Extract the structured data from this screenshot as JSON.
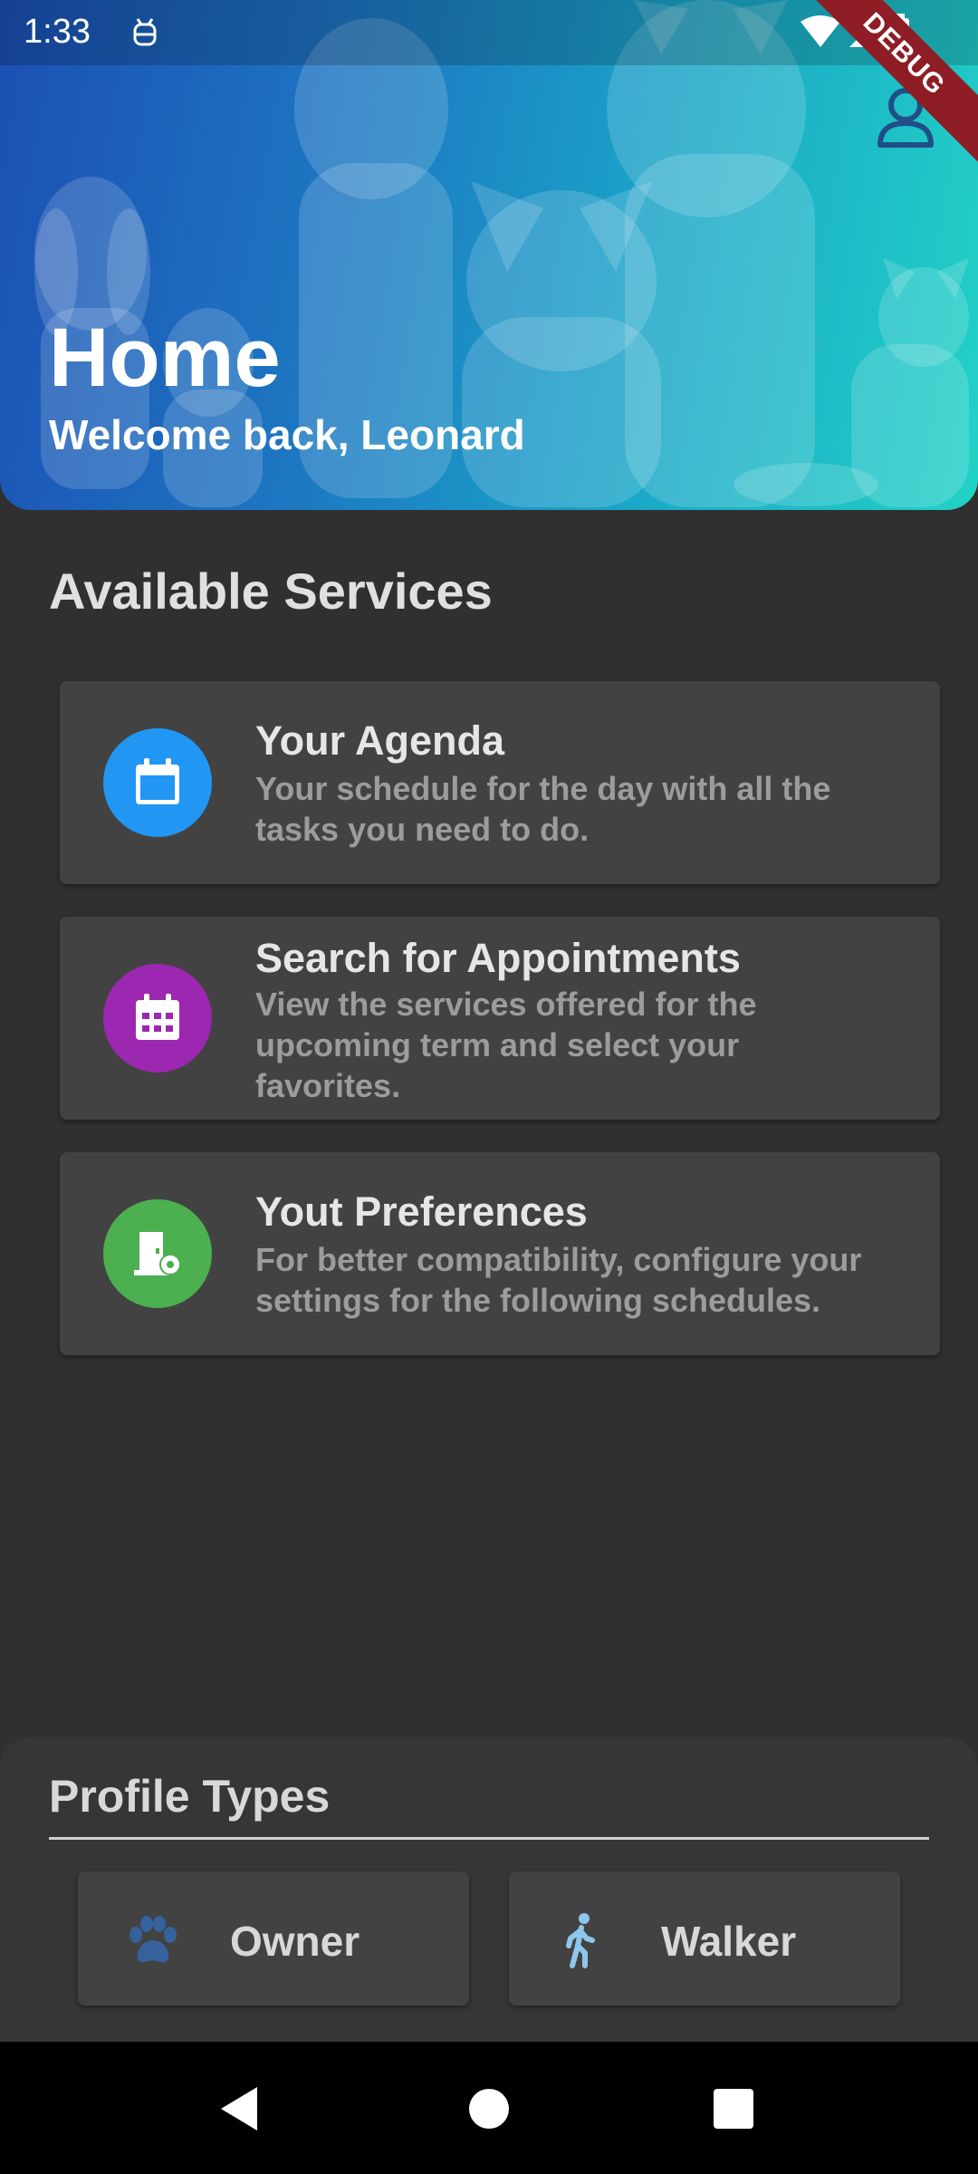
{
  "status_bar": {
    "time": "1:33",
    "icons": [
      "android-debug-icon",
      "wifi-icon",
      "signal-icon",
      "battery-icon"
    ]
  },
  "debug_banner": "DEBUG",
  "header": {
    "title": "Home",
    "subtitle": "Welcome back, Leonard",
    "profile_icon": "person-outline-icon"
  },
  "services": {
    "section_title": "Available Services",
    "items": [
      {
        "title": "Your Agenda",
        "description": "Your schedule for the day with all the tasks you need to do.",
        "icon": "calendar-icon",
        "color": "#2196f3"
      },
      {
        "title": "Search for Appointments",
        "description": "View the services offered for the upcoming term and select your favorites.",
        "icon": "calendar-month-icon",
        "color": "#9c27b0"
      },
      {
        "title": "Yout Preferences",
        "description": "For better compatibility, configure your settings for the following schedules.",
        "icon": "settings-door-icon",
        "color": "#4caf50"
      }
    ]
  },
  "profile_types": {
    "title": "Profile Types",
    "options": [
      {
        "label": "Owner",
        "icon": "paw-icon",
        "icon_color": "#35619c"
      },
      {
        "label": "Walker",
        "icon": "walking-person-icon",
        "icon_color": "#8ec7ec"
      }
    ]
  },
  "navigation": {
    "buttons": [
      "back-icon",
      "home-icon",
      "recents-icon"
    ]
  },
  "colors": {
    "background": "#303030",
    "card": "#424242",
    "header_gradient_start": "#1c4fb3",
    "header_gradient_end": "#22d2c6",
    "debug_red": "#8e1d25"
  }
}
